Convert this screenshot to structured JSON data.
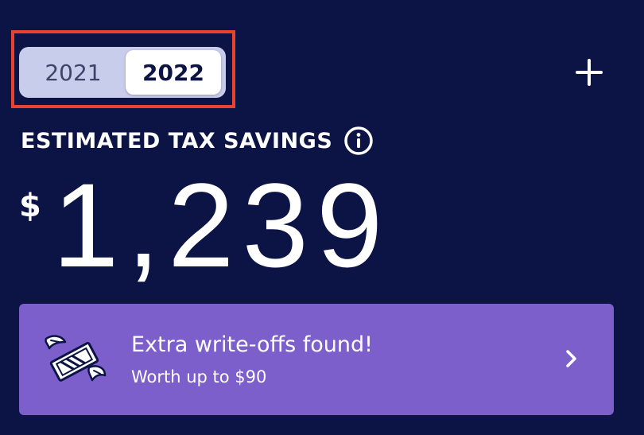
{
  "year_toggle": {
    "options": [
      {
        "label": "2021",
        "selected": false
      },
      {
        "label": "2022",
        "selected": true
      }
    ]
  },
  "header": {
    "add_icon": "plus-icon"
  },
  "savings": {
    "label": "ESTIMATED TAX SAVINGS",
    "info_icon": "info-icon",
    "currency": "$",
    "amount": "1,239"
  },
  "writeoffs_card": {
    "title": "Extra write-offs found!",
    "subtitle": "Worth up to $90",
    "icon": "flying-money-icon",
    "chevron_icon": "chevron-right-icon"
  },
  "colors": {
    "background": "#0b1445",
    "toggle_track": "#c9cdec",
    "card_background": "#7d5fcc",
    "highlight_border": "#e8432e"
  }
}
